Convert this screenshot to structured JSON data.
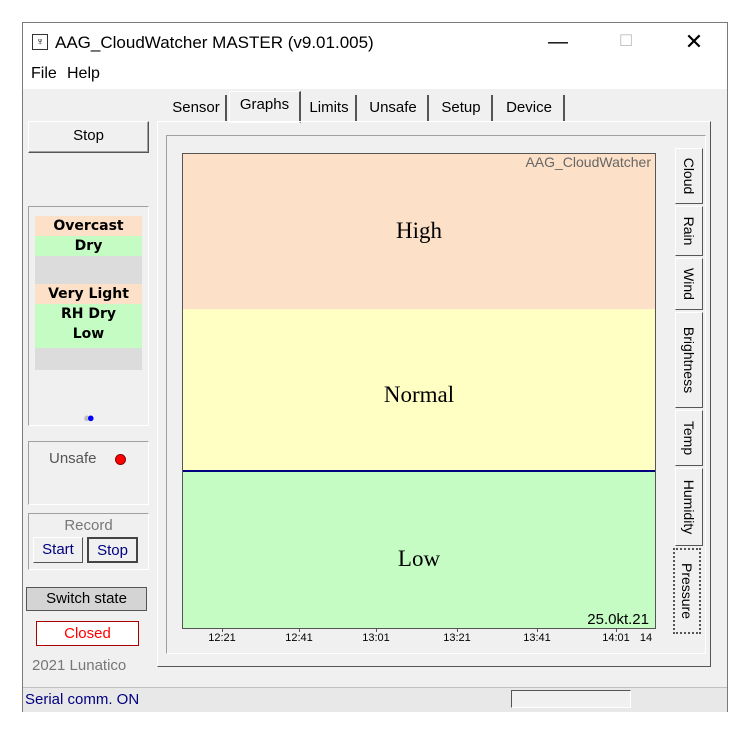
{
  "window": {
    "title": "AAG_CloudWatcher MASTER (v9.01.005)",
    "minimize": "—",
    "maximize": "☐",
    "close": "✕"
  },
  "menu": [
    "File",
    "Help"
  ],
  "left": {
    "stop_button": "Stop",
    "status_items": [
      {
        "label": "Overcast",
        "color": "#fce0c8"
      },
      {
        "label": "Dry",
        "color": "#c4fcc4"
      },
      {
        "label": "",
        "color": "#dcdcdc"
      },
      {
        "label": "Very Light",
        "color": "#fce0c8"
      },
      {
        "label": "RH Dry",
        "color": "#c4fcc4"
      },
      {
        "label": "Low",
        "color": "#c4fcc4"
      },
      {
        "label": "",
        "color": "#dcdcdc"
      }
    ],
    "unsafe_label": "Unsafe",
    "record_label": "Record",
    "record_start": "Start",
    "record_stop": "Stop",
    "switch_state": "Switch state",
    "closed": "Closed",
    "copyright": "2021 Lunatico"
  },
  "tabs": [
    {
      "label": "Sensor",
      "active": false
    },
    {
      "label": "Graphs",
      "active": true
    },
    {
      "label": "Limits",
      "active": false
    },
    {
      "label": "Unsafe",
      "active": false
    },
    {
      "label": "Setup",
      "active": false
    },
    {
      "label": "Device",
      "active": false
    }
  ],
  "vertical_tabs": [
    {
      "label": "Cloud",
      "active": false
    },
    {
      "label": "Rain",
      "active": false
    },
    {
      "label": "Wind",
      "active": false
    },
    {
      "label": "Brightness",
      "active": false
    },
    {
      "label": "Temp",
      "active": false
    },
    {
      "label": "Humidity",
      "active": false
    },
    {
      "label": "Pressure",
      "active": true
    }
  ],
  "graph": {
    "watermark": "AAG_CloudWatcher",
    "band_high": "High",
    "band_normal": "Normal",
    "band_low": "Low",
    "date": "25.0kt.21",
    "x_ticks": [
      "12:21",
      "12:41",
      "13:01",
      "13:21",
      "13:41",
      "14:01",
      "14"
    ]
  },
  "statusbar": {
    "text": "Serial comm. ON"
  }
}
